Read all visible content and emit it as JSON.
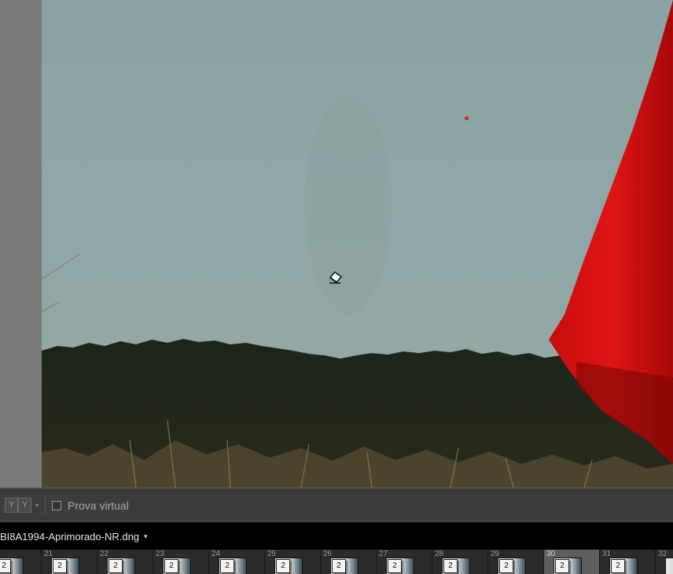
{
  "toolbar": {
    "yy_left": "Y",
    "yy_right": "Y",
    "dropdown_caret": "▾",
    "soft_proof_label": "Prova virtual",
    "soft_proof_checked": false
  },
  "filebar": {
    "filename": "BI8A1994-Aprimorado-NR.dng",
    "caret": "▾"
  },
  "filmstrip": {
    "cells": [
      {
        "num": "",
        "stack": "2",
        "selected": false
      },
      {
        "num": "21",
        "stack": "2",
        "selected": false
      },
      {
        "num": "22",
        "stack": "2",
        "selected": false
      },
      {
        "num": "23",
        "stack": "2",
        "selected": false
      },
      {
        "num": "24",
        "stack": "2",
        "selected": false
      },
      {
        "num": "25",
        "stack": "2",
        "selected": false
      },
      {
        "num": "26",
        "stack": "2",
        "selected": false
      },
      {
        "num": "27",
        "stack": "2",
        "selected": false
      },
      {
        "num": "28",
        "stack": "2",
        "selected": false
      },
      {
        "num": "29",
        "stack": "2",
        "selected": false
      },
      {
        "num": "30",
        "stack": "2",
        "selected": true
      },
      {
        "num": "31",
        "stack": "2",
        "selected": false
      },
      {
        "num": "32",
        "stack": "",
        "selected": false
      }
    ]
  },
  "colors": {
    "sky": "#8fa6a6",
    "forest": "#1f2a1e",
    "dress_red": "#d01010",
    "cursor_dot": "#e02020"
  },
  "icons": {
    "cursor": "spot-removal-brush-icon",
    "checkbox": "checkbox-icon"
  }
}
